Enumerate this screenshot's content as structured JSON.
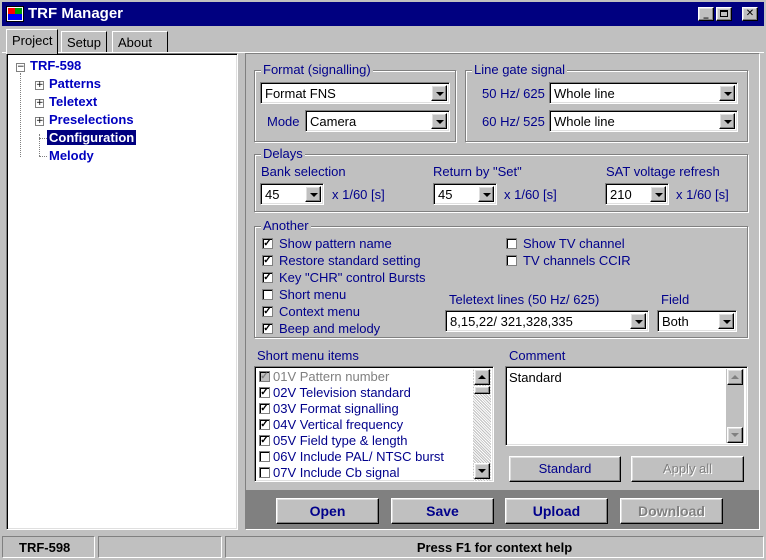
{
  "window": {
    "title": "TRF Manager"
  },
  "tabs": [
    "Project",
    "Setup",
    "About"
  ],
  "tree": {
    "root": "TRF-598",
    "items": [
      "Patterns",
      "Teletext",
      "Preselections",
      "Configuration",
      "Melody"
    ],
    "selected": "Configuration"
  },
  "format": {
    "group_label": "Format (signalling)",
    "format_value": "Format FNS",
    "mode_label": "Mode",
    "mode_value": "Camera"
  },
  "linegate": {
    "group_label": "Line gate signal",
    "hz50_label": "50 Hz/ 625",
    "hz50_value": "Whole line",
    "hz60_label": "60 Hz/ 525",
    "hz60_value": "Whole line"
  },
  "delays": {
    "group_label": "Delays",
    "bank_label": "Bank selection",
    "bank_value": "45",
    "return_label": "Return by \"Set\"",
    "return_value": "45",
    "sat_label": "SAT voltage refresh",
    "sat_value": "210",
    "unit": "x 1/60 [s]"
  },
  "another": {
    "group_label": "Another",
    "checks": [
      {
        "label": "Show pattern name",
        "checked": true
      },
      {
        "label": "Restore standard setting",
        "checked": true
      },
      {
        "label": "Key \"CHR\" control Bursts",
        "checked": true
      },
      {
        "label": "Short menu",
        "checked": false
      },
      {
        "label": "Context menu",
        "checked": true
      },
      {
        "label": "Beep and melody",
        "checked": true
      }
    ],
    "tv_checks": [
      {
        "label": "Show TV channel",
        "checked": false
      },
      {
        "label": "TV channels CCIR",
        "checked": false
      }
    ],
    "teletext_label": "Teletext lines (50 Hz/ 625)",
    "teletext_value": "8,15,22/ 321,328,335",
    "field_label": "Field",
    "field_value": "Both"
  },
  "short_menu": {
    "label": "Short menu items",
    "items": [
      {
        "label": "01V Pattern number",
        "checked": true,
        "disabled": true
      },
      {
        "label": "02V Television standard",
        "checked": true,
        "disabled": false
      },
      {
        "label": "03V Format signalling",
        "checked": true,
        "disabled": false
      },
      {
        "label": "04V Vertical frequency",
        "checked": true,
        "disabled": false
      },
      {
        "label": "05V Field type & length",
        "checked": true,
        "disabled": false
      },
      {
        "label": "06V Include PAL/ NTSC burst",
        "checked": false,
        "disabled": false
      },
      {
        "label": "07V Include Cb signal",
        "checked": false,
        "disabled": false
      }
    ]
  },
  "comment": {
    "label": "Comment",
    "value": "Standard",
    "standard_button": "Standard",
    "apply_all_button": "Apply all"
  },
  "actions": {
    "open": "Open",
    "save": "Save",
    "upload": "Upload",
    "download": "Download"
  },
  "status": {
    "device": "TRF-598",
    "hint": "Press F1 for context help"
  }
}
